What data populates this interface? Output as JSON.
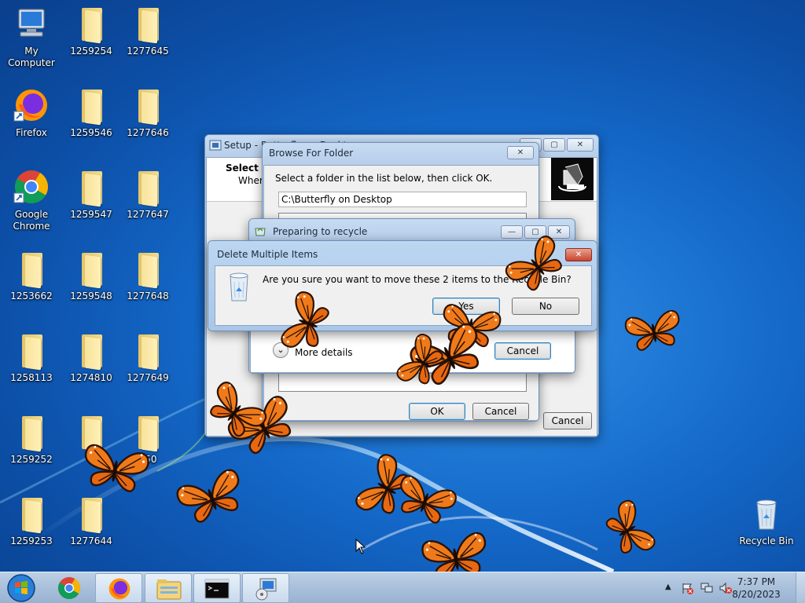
{
  "desktop_icons": [
    {
      "id": "my-computer",
      "label": "My Computer",
      "type": "computer"
    },
    {
      "id": "firefox",
      "label": "Firefox",
      "type": "firefox"
    },
    {
      "id": "google-chrome",
      "label": "Google Chrome",
      "type": "chrome"
    },
    {
      "id": "f1253662",
      "label": "1253662",
      "type": "folder"
    },
    {
      "id": "f1258113",
      "label": "1258113",
      "type": "folder"
    },
    {
      "id": "f1259252",
      "label": "1259252",
      "type": "folder"
    },
    {
      "id": "f1259253",
      "label": "1259253",
      "type": "folder"
    },
    {
      "id": "f1259254",
      "label": "1259254",
      "type": "folder"
    },
    {
      "id": "f1259546",
      "label": "1259546",
      "type": "folder"
    },
    {
      "id": "f1259547",
      "label": "1259547",
      "type": "folder"
    },
    {
      "id": "f1259548",
      "label": "1259548",
      "type": "folder"
    },
    {
      "id": "f1274810",
      "label": "1274810",
      "type": "folder"
    },
    {
      "id": "f12col2r6",
      "label": "",
      "type": "folder"
    },
    {
      "id": "f1277644",
      "label": "1277644",
      "type": "folder"
    },
    {
      "id": "f1277645",
      "label": "1277645",
      "type": "folder"
    },
    {
      "id": "f1277646",
      "label": "1277646",
      "type": "folder"
    },
    {
      "id": "f1277647",
      "label": "1277647",
      "type": "folder"
    },
    {
      "id": "f1277648",
      "label": "1277648",
      "type": "folder"
    },
    {
      "id": "f1277649",
      "label": "1277649",
      "type": "folder"
    },
    {
      "id": "f1277650",
      "label": "650",
      "type": "folder"
    },
    {
      "id": "recycle-bin",
      "label": "Recycle Bin",
      "type": "recycle"
    }
  ],
  "setup_window": {
    "title": "Setup - Butterfly on Desktop",
    "heading": "Select D",
    "subheading": "Where",
    "cancel_label": "Cancel"
  },
  "browse_dialog": {
    "title": "Browse For Folder",
    "instruction": "Select a folder in the list below, then click OK.",
    "path_value": "C:\\Butterfly on Desktop",
    "ok_label": "OK",
    "cancel_label": "Cancel"
  },
  "recycle_progress": {
    "title": "Preparing to recycle",
    "details_label": "More details",
    "cancel_label": "Cancel"
  },
  "delete_dialog": {
    "title": "Delete Multiple Items",
    "message": "Are you sure you want to move these 2 items to the Recycle Bin?",
    "yes_label": "Yes",
    "no_label": "No"
  },
  "taskbar": {
    "start_label": "Start",
    "pinned": [
      {
        "id": "chrome",
        "icon": "chrome-icon",
        "active": false
      },
      {
        "id": "firefox",
        "icon": "firefox-icon",
        "active": true
      },
      {
        "id": "explorer",
        "icon": "explorer-icon",
        "active": true
      },
      {
        "id": "cmd",
        "icon": "cmd-icon",
        "active": true
      },
      {
        "id": "setup",
        "icon": "setup-icon",
        "active": true
      }
    ],
    "clock_time": "7:37 PM",
    "clock_date": "8/20/2023"
  },
  "colors": {
    "desktop_blue": "#1468c8",
    "butterfly_orange": "#f07a1a",
    "butterfly_vein": "#2a1206"
  }
}
